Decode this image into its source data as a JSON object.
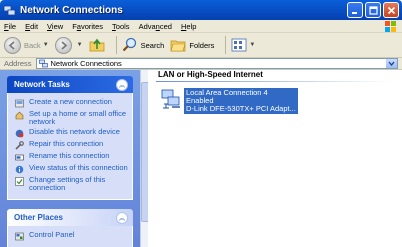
{
  "window": {
    "title": "Network Connections"
  },
  "menu": [
    {
      "pre": "",
      "key": "F",
      "post": "ile"
    },
    {
      "pre": "",
      "key": "E",
      "post": "dit"
    },
    {
      "pre": "",
      "key": "V",
      "post": "iew"
    },
    {
      "pre": "F",
      "key": "a",
      "post": "vorites"
    },
    {
      "pre": "",
      "key": "T",
      "post": "ools"
    },
    {
      "pre": "Adva",
      "key": "n",
      "post": "ced"
    },
    {
      "pre": "",
      "key": "H",
      "post": "elp"
    }
  ],
  "toolbar": {
    "back_label": "Back",
    "search_label": "Search",
    "folders_label": "Folders"
  },
  "address": {
    "label": "Address",
    "value": "Network Connections"
  },
  "tasks_panel": {
    "title": "Network Tasks",
    "items": [
      {
        "label": "Create a new connection",
        "icon": "new-connection-icon"
      },
      {
        "label": "Set up a home or small office network",
        "icon": "home-network-icon"
      },
      {
        "label": "Disable this network device",
        "icon": "disable-device-icon"
      },
      {
        "label": "Repair this connection",
        "icon": "repair-icon"
      },
      {
        "label": "Rename this connection",
        "icon": "rename-icon"
      },
      {
        "label": "View status of this connection",
        "icon": "status-icon"
      },
      {
        "label": "Change settings of this connection",
        "icon": "settings-icon"
      }
    ]
  },
  "places_panel": {
    "title": "Other Places",
    "items": [
      {
        "label": "Control Panel",
        "icon": "control-panel-icon"
      }
    ]
  },
  "content": {
    "group_title": "LAN or High-Speed Internet",
    "connection": {
      "name": "Local Area Connection 4",
      "status": "Enabled",
      "device": "D-Link DFE-530TX+ PCI Adapt..."
    }
  },
  "colors": {
    "titlebar": "#0a5fd8",
    "task_pane": "#6f94e0",
    "selection": "#316ac5",
    "link": "#215dc6"
  }
}
